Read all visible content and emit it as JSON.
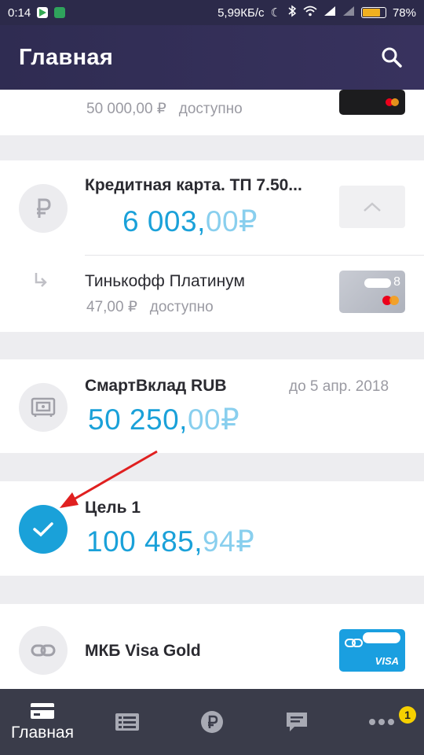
{
  "status": {
    "time": "0:14",
    "net_speed": "5,99КБ/с",
    "battery": "78%",
    "battery_level": 0.78
  },
  "header": {
    "title": "Главная"
  },
  "accounts": {
    "top_card": {
      "available_amount": "50 000,00 ₽",
      "available_label": "доступно"
    },
    "credit_card": {
      "name": "Кредитная карта. ТП 7.50...",
      "amount_int": "6 003,",
      "amount_frac": "00",
      "currency": "₽",
      "sub_card": {
        "name": "Тинькофф Платинум",
        "available_amount": "47,00 ₽",
        "available_label": "доступно",
        "card_tail": "8"
      }
    },
    "deposit": {
      "name": "СмартВклад RUB",
      "date": "до 5 апр. 2018",
      "amount_int": "50 250,",
      "amount_frac": "00",
      "currency": "₽"
    },
    "goal": {
      "name": "Цель 1",
      "amount_int": "100 485,",
      "amount_frac": "94",
      "currency": "₽"
    },
    "linked_card": {
      "name": "МКБ Visa Gold",
      "brand": "VISA"
    }
  },
  "bottom_nav": {
    "items": [
      {
        "label": "Главная",
        "icon": "card-icon",
        "active": true
      },
      {
        "label": "",
        "icon": "list-icon"
      },
      {
        "label": "",
        "icon": "ruble-icon"
      },
      {
        "label": "",
        "icon": "chat-icon"
      },
      {
        "label": "",
        "icon": "more-icon",
        "badge": "1"
      }
    ]
  },
  "colors": {
    "accent": "#1aa1d9",
    "accent_light": "#89cfee",
    "header": "#2f2c52",
    "nav": "#3a3c4a",
    "arrow": "#e02020",
    "badge": "#f6d000"
  }
}
